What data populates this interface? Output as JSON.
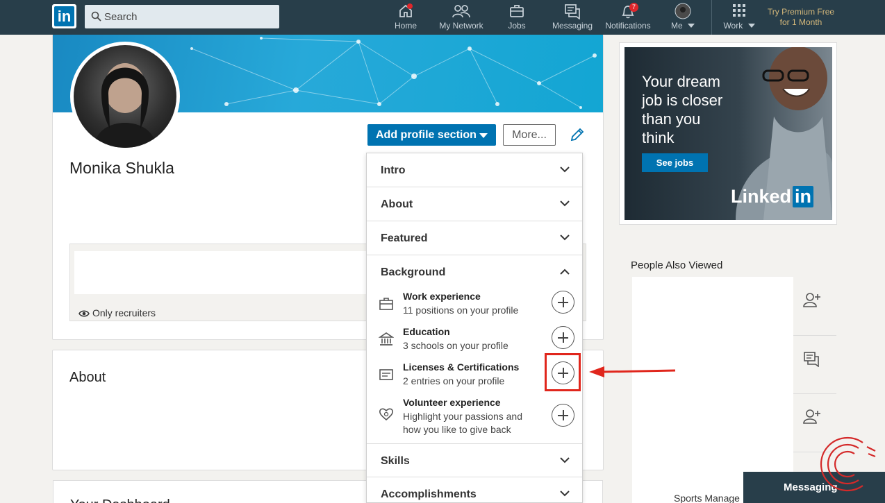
{
  "nav": {
    "search_placeholder": "Search",
    "items": [
      {
        "label": "Home",
        "icon": "home-icon",
        "badge": ""
      },
      {
        "label": "My Network",
        "icon": "network-icon",
        "badge": ""
      },
      {
        "label": "Jobs",
        "icon": "briefcase-icon",
        "badge": ""
      },
      {
        "label": "Messaging",
        "icon": "messaging-icon",
        "badge": ""
      },
      {
        "label": "Notifications",
        "icon": "bell-icon",
        "badge": "7"
      },
      {
        "label": "Me",
        "icon": "avatar-icon",
        "badge": ""
      }
    ],
    "work_label": "Work",
    "premium_line1": "Try Premium Free",
    "premium_line2": "for 1 Month"
  },
  "profile": {
    "name": "Monika Shukla",
    "add_section_label": "Add profile section",
    "more_label": "More...",
    "visibility_label": "Only recruiters"
  },
  "about": {
    "title": "About"
  },
  "dashboard": {
    "title": "Your Dashboard"
  },
  "dropdown": {
    "sections": [
      "Intro",
      "About",
      "Featured",
      "Background",
      "Skills",
      "Accomplishments"
    ],
    "background_items": [
      {
        "title": "Work experience",
        "sub": "11 positions on your profile",
        "icon": "briefcase-icon"
      },
      {
        "title": "Education",
        "sub": "3 schools on your profile",
        "icon": "school-icon"
      },
      {
        "title": "Licenses & Certifications",
        "sub": "2 entries on your profile",
        "icon": "certificate-icon"
      },
      {
        "title": "Volunteer experience",
        "sub": "Highlight your passions and how you like to give back",
        "icon": "volunteer-heart-icon"
      }
    ]
  },
  "ad": {
    "headline": "Your dream job is closer than you think",
    "cta": "See jobs",
    "brand": "Linked",
    "brand_in": "in"
  },
  "rail": {
    "people_also_viewed": "People Also Viewed",
    "messaging_label": "Messaging",
    "sports_text": "Sports Manage"
  },
  "colors": {
    "nav_bg": "#283e4a",
    "brand_blue": "#0073b1",
    "highlight_red": "#e0261c"
  }
}
